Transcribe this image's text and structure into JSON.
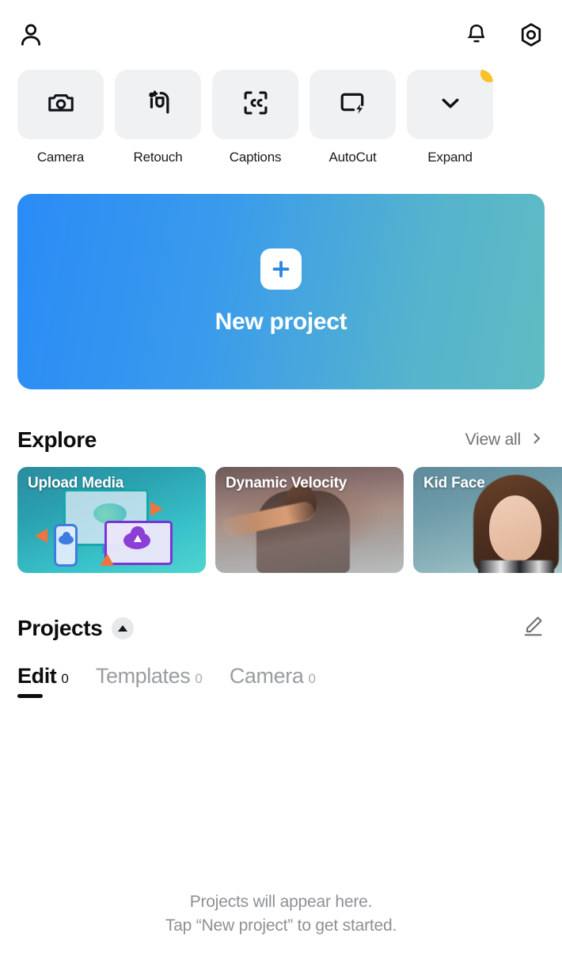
{
  "topbar": {
    "profile_icon": "person-icon",
    "notifications_icon": "bell-icon",
    "settings_icon": "hex-gear-icon"
  },
  "quick_actions": [
    {
      "label": "Camera",
      "icon": "camera-icon",
      "badge": false
    },
    {
      "label": "Retouch",
      "icon": "face-sparkle-icon",
      "badge": false
    },
    {
      "label": "Captions",
      "icon": "closed-caption-icon",
      "badge": false
    },
    {
      "label": "AutoCut",
      "icon": "screen-bolt-icon",
      "badge": true
    },
    {
      "label": "Expand",
      "icon": "chevron-down-icon",
      "badge": true
    }
  ],
  "new_project": {
    "label": "New project",
    "plus_icon": "plus-icon",
    "gradient_from": "#2a8bf6",
    "gradient_to": "#5fbcc3"
  },
  "explore": {
    "title": "Explore",
    "view_all": "View all",
    "chevron_icon": "chevron-right-icon",
    "cards": [
      {
        "title": "Upload Media"
      },
      {
        "title": "Dynamic Velocity"
      },
      {
        "title": "Kid Face"
      }
    ]
  },
  "projects": {
    "title": "Projects",
    "collapse_icon": "triangle-up-icon",
    "edit_icon": "pencil-icon",
    "tabs": [
      {
        "label": "Edit",
        "count": "0",
        "active": true
      },
      {
        "label": "Templates",
        "count": "0",
        "active": false
      },
      {
        "label": "Camera",
        "count": "0",
        "active": false
      }
    ],
    "empty_line1": "Projects will appear here.",
    "empty_line2": "Tap “New project” to get started."
  }
}
